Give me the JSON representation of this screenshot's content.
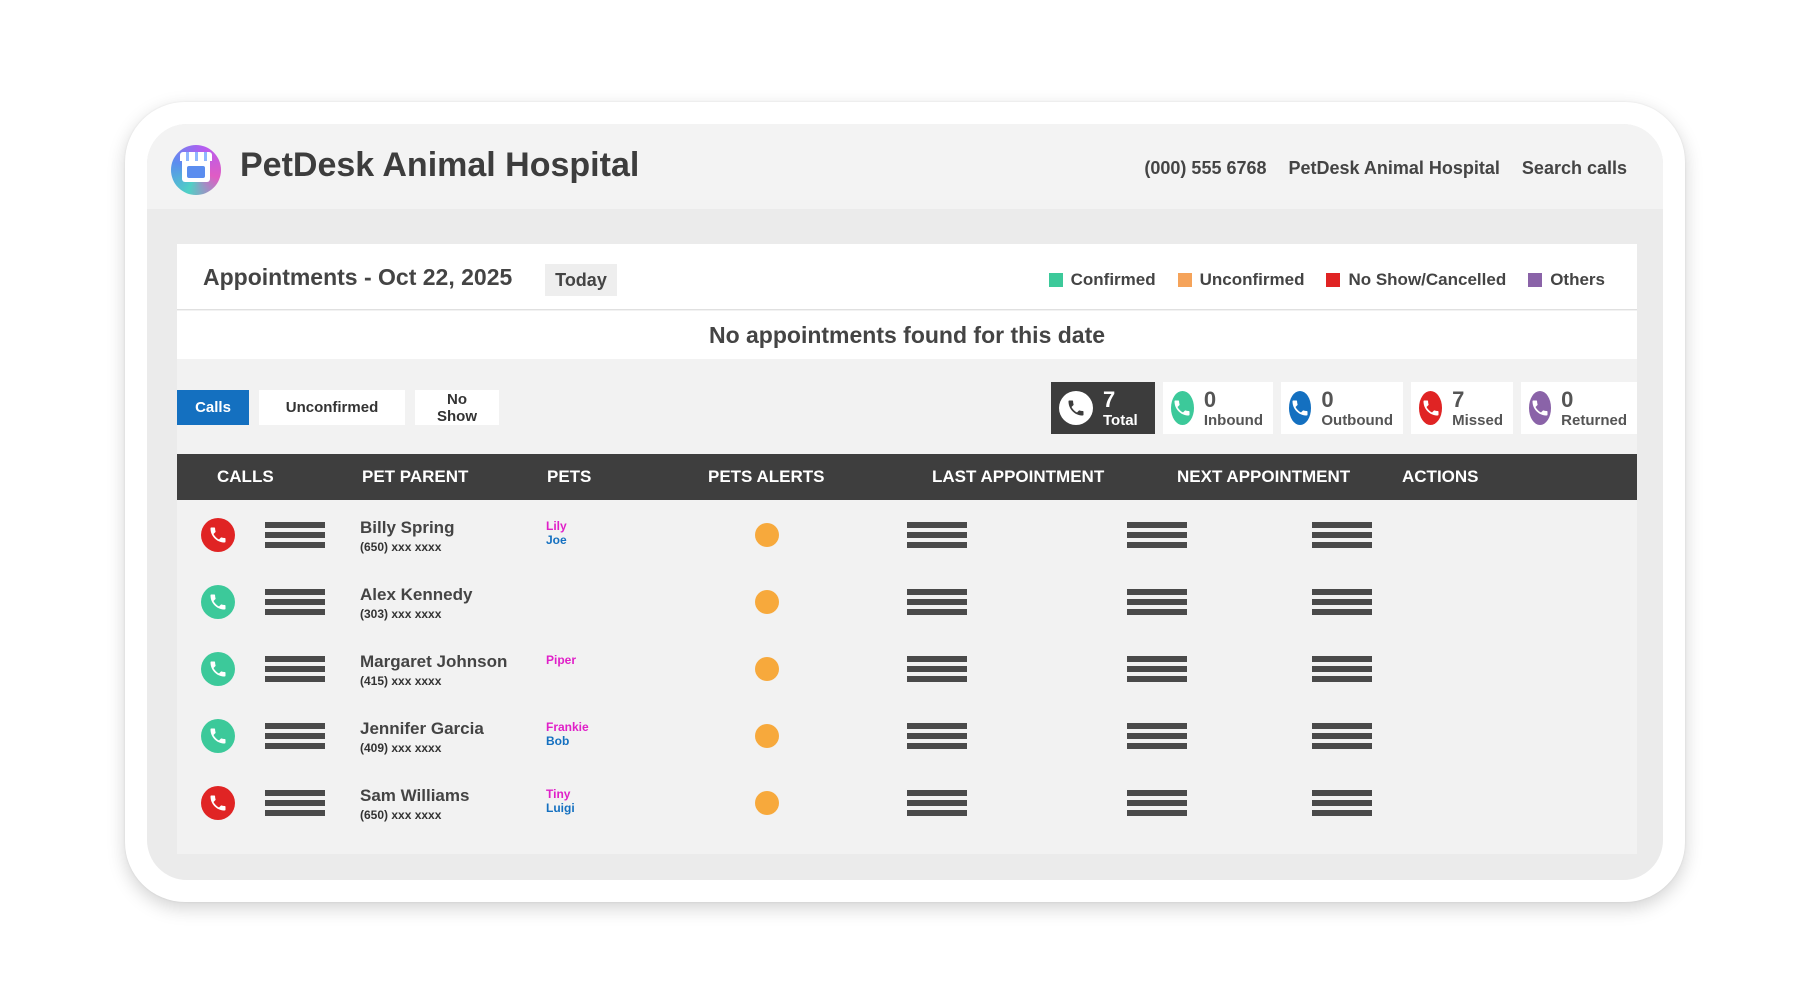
{
  "app": {
    "hospital_name": "PetDesk Animal Hospital",
    "logo_icon": "storefront-icon"
  },
  "header_links": {
    "phone": "(000) 555 6768",
    "location": "PetDesk Animal Hospital",
    "search": "Search calls"
  },
  "appointments": {
    "title": "Appointments - Oct 22, 2025",
    "today_label": "Today",
    "empty_message": "No appointments found for this date",
    "legend": [
      {
        "label": "Confirmed",
        "color": "#3cc99a"
      },
      {
        "label": "Unconfirmed",
        "color": "#f5a35a"
      },
      {
        "label": "No Show/Cancelled",
        "color": "#e02424"
      },
      {
        "label": "Others",
        "color": "#8a63a8"
      }
    ]
  },
  "filters": [
    {
      "label": "Calls",
      "active": true
    },
    {
      "label": "Unconfirmed",
      "active": false
    },
    {
      "label": "No Show",
      "active": false
    }
  ],
  "stats": [
    {
      "count": "7",
      "label": "Total",
      "color": "#ffffff",
      "icon": "phone-icon"
    },
    {
      "count": "0",
      "label": "Inbound",
      "color": "#3cc99a",
      "icon": "phone-inbound-icon"
    },
    {
      "count": "0",
      "label": "Outbound",
      "color": "#1470c0",
      "icon": "phone-outbound-icon"
    },
    {
      "count": "7",
      "label": "Missed",
      "color": "#e02424",
      "icon": "phone-missed-icon"
    },
    {
      "count": "0",
      "label": "Returned",
      "color": "#8a63a8",
      "icon": "phone-returned-icon"
    }
  ],
  "table": {
    "columns": [
      "CALLS",
      "PET PARENT",
      "PETS",
      "PETS ALERTS",
      "LAST APPOINTMENT",
      "NEXT APPOINTMENT",
      "ACTIONS"
    ],
    "rows": [
      {
        "call_status": "missed",
        "call_color": "#e02424",
        "parent": "Billy Spring",
        "phone": "(650) xxx xxxx",
        "pets": [
          {
            "name": "Lily",
            "color": "#e020c8"
          },
          {
            "name": "Joe",
            "color": "#1470c0"
          }
        ]
      },
      {
        "call_status": "inbound",
        "call_color": "#3cc99a",
        "parent": "Alex Kennedy",
        "phone": "(303) xxx xxxx",
        "pets": []
      },
      {
        "call_status": "inbound",
        "call_color": "#3cc99a",
        "parent": "Margaret Johnson",
        "phone": "(415) xxx xxxx",
        "pets": [
          {
            "name": "Piper",
            "color": "#e020c8"
          }
        ]
      },
      {
        "call_status": "inbound",
        "call_color": "#3cc99a",
        "parent": "Jennifer Garcia",
        "phone": "(409) xxx xxxx",
        "pets": [
          {
            "name": "Frankie",
            "color": "#e020c8"
          },
          {
            "name": "Bob",
            "color": "#1470c0"
          }
        ]
      },
      {
        "call_status": "missed",
        "call_color": "#e02424",
        "parent": "Sam Williams",
        "phone": "(650) xxx xxxx",
        "pets": [
          {
            "name": "Tiny",
            "color": "#e020c8"
          },
          {
            "name": "Luigi",
            "color": "#1470c0"
          }
        ]
      }
    ]
  }
}
